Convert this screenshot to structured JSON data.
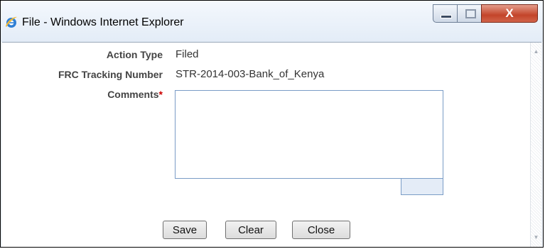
{
  "window": {
    "title": "File - Windows Internet Explorer",
    "close_glyph": "X",
    "icons": {
      "app": "internet-explorer-icon",
      "minimize": "minimize-icon",
      "maximize": "maximize-icon",
      "close": "close-icon"
    }
  },
  "form": {
    "action_type": {
      "label": "Action Type",
      "value": "Filed"
    },
    "frc_tracking": {
      "label": "FRC Tracking Number",
      "value": "STR-2014-003-Bank_of_Kenya"
    },
    "comments": {
      "label": "Comments",
      "required_mark": "*",
      "value": ""
    }
  },
  "buttons": {
    "save": "Save",
    "clear": "Clear",
    "close": "Close"
  },
  "colors": {
    "required": "#cc0000",
    "close_button": "#c3452a",
    "input_border": "#7a9cc6"
  }
}
